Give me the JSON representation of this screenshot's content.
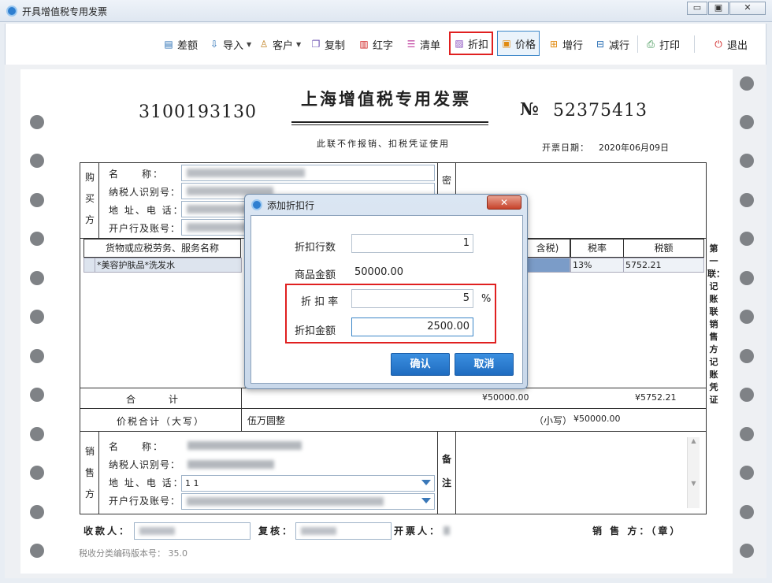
{
  "window": {
    "title": "开具增值税专用发票",
    "min": "▭",
    "max": "▣",
    "close": "✕"
  },
  "toolbar": {
    "diff": "差额",
    "import": "导入",
    "customer": "客户",
    "copy": "复制",
    "red": "红字",
    "list": "清单",
    "discount": "折扣",
    "price": "价格",
    "add_row": "增行",
    "del_row": "减行",
    "print": "打印",
    "exit": "退出"
  },
  "icons": {
    "diff": "calculator-icon",
    "import": "import-icon",
    "customer": "customer-icon",
    "copy": "copy-icon",
    "red": "red-invoice-icon",
    "list": "list-icon",
    "discount": "discount-icon",
    "price": "price-icon",
    "add_row": "add-row-icon",
    "del_row": "delete-row-icon",
    "print": "printer-icon",
    "exit": "power-icon"
  },
  "invoice": {
    "code": "3100193130",
    "title": "上海增值税专用发票",
    "no_sign": "№",
    "number": "52375413",
    "subtitle": "此联不作报销、扣税凭证使用",
    "date_label": "开票日期：",
    "date": "2020年06月09日",
    "buyer_side": [
      "购",
      "买",
      "方"
    ],
    "buyer_labels": {
      "name": "名　　称：",
      "tax_id": "纳税人识别号：",
      "addr": "地 址、电 话：",
      "bank": "开户行及账号："
    },
    "secret_label": "密",
    "goods_headers": {
      "name": "货物或应税劳务、服务名称",
      "price_incl": "含税)",
      "rate": "税率",
      "tax": "税额"
    },
    "goods_rows": [
      {
        "name": "*美容护肤品*洗发水",
        "rate": "13%",
        "tax": "5752.21"
      }
    ],
    "total_label": "合　　计",
    "total_amount": "¥50000.00",
    "total_tax": "¥5752.21",
    "grand_label": "价税合计（大写）",
    "grand_upper": "伍万圆整",
    "grand_small_label": "（小写）",
    "grand_small": "¥50000.00",
    "seller_side": [
      "销",
      "售",
      "方"
    ],
    "seller_labels": {
      "name": "名　　称：",
      "tax_id": "纳税人识别号：",
      "addr": "地 址、电 话：",
      "bank": "开户行及账号："
    },
    "seller_addr_value": "1 1",
    "remark_label": [
      "备",
      "注"
    ],
    "side_copy_text": "第一联：记账联 销售方记账凭证",
    "footer": {
      "payee": "收款人：",
      "reviewer": "复核：",
      "issuer": "开票人：",
      "seller_seal": "销 售 方：（章）"
    },
    "version_label": "税收分类编码版本号：",
    "version": "35.0"
  },
  "dialog": {
    "title": "添加折扣行",
    "close": "✕",
    "rows_label": "折扣行数",
    "rows_value": "1",
    "amount_label": "商品金额",
    "amount_value": "50000.00",
    "rate_label": "折 扣 率",
    "rate_value": "5",
    "rate_unit": "%",
    "disc_label": "折扣金额",
    "disc_value": "2500.00",
    "ok": "确认",
    "cancel": "取消"
  }
}
